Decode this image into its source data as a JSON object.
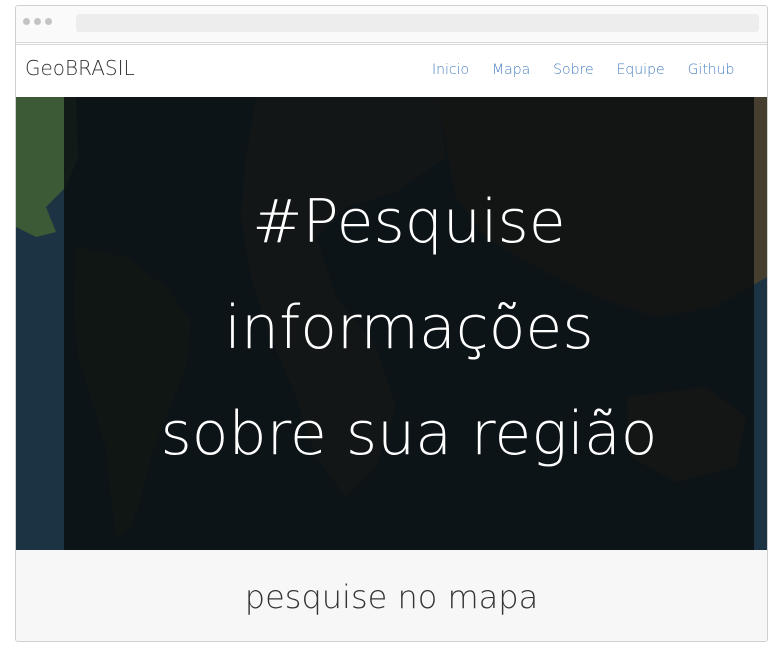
{
  "browser": {
    "dots": [
      "dot",
      "dot",
      "dot"
    ]
  },
  "navbar": {
    "brand": "GeoBRASIL",
    "links": [
      "Inicio",
      "Mapa",
      "Sobre",
      "Equipe",
      "Github"
    ]
  },
  "hero": {
    "lines": [
      "#Pesquise",
      "informações",
      "sobre sua região"
    ],
    "background": "satellite-world-map"
  },
  "cta": {
    "label": "pesquise no mapa"
  },
  "colors": {
    "nav_link": "#4a7fbf",
    "hero_overlay": "#0b0f12",
    "cta_bg": "#f7f7f7"
  }
}
